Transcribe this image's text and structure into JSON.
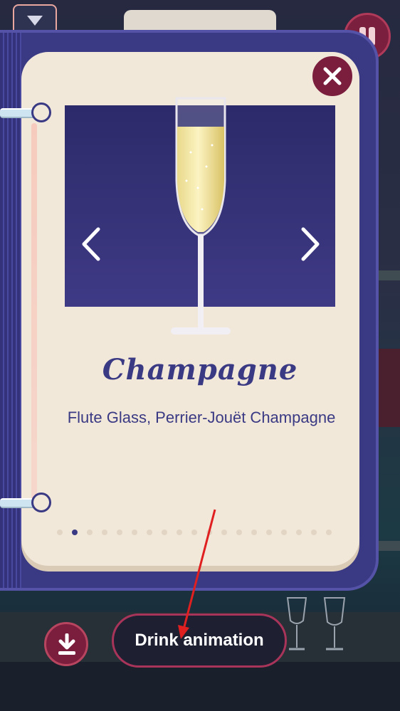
{
  "drink": {
    "name": "Champagne",
    "description": "Flute Glass, Perrier-Jouët Champagne"
  },
  "carousel": {
    "page_count": 19,
    "active_index": 1
  },
  "actions": {
    "drink_animation_label": "Drink animation"
  },
  "icons": {
    "close": "close-icon",
    "prev": "chevron-left-icon",
    "next": "chevron-right-icon",
    "download": "download-icon",
    "pause": "pause-icon",
    "dropdown": "triangle-down-icon"
  },
  "colors": {
    "book": "#3a3983",
    "page": "#f1e8da",
    "accent": "#7b1d3d",
    "title": "#3a3983",
    "annotation_arrow": "#e02020"
  }
}
